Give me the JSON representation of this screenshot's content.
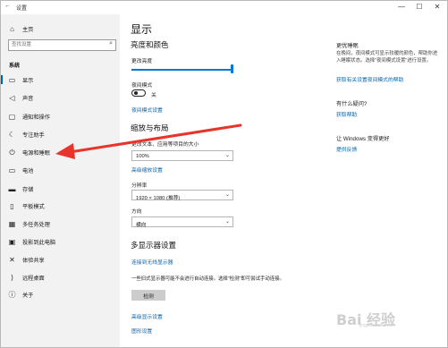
{
  "window": {
    "title": "设置",
    "minimize": "—",
    "maximize": "☐",
    "close": "✕"
  },
  "sidebar": {
    "home": "主页",
    "search_placeholder": "查找设置",
    "section": "系统",
    "items": [
      {
        "label": "显示",
        "icon": "monitor-icon"
      },
      {
        "label": "声音",
        "icon": "speaker-icon"
      },
      {
        "label": "通知和操作",
        "icon": "notification-icon"
      },
      {
        "label": "专注助手",
        "icon": "moon-icon"
      },
      {
        "label": "电源和睡眠",
        "icon": "power-icon"
      },
      {
        "label": "电池",
        "icon": "battery-icon"
      },
      {
        "label": "存储",
        "icon": "storage-icon"
      },
      {
        "label": "平板模式",
        "icon": "tablet-icon"
      },
      {
        "label": "多任务处理",
        "icon": "multitask-icon"
      },
      {
        "label": "投影到此电脑",
        "icon": "project-icon"
      },
      {
        "label": "体验共享",
        "icon": "share-icon"
      },
      {
        "label": "远程桌面",
        "icon": "remote-icon"
      },
      {
        "label": "关于",
        "icon": "info-icon"
      }
    ]
  },
  "main": {
    "title": "显示",
    "brightness_heading": "亮度和颜色",
    "brightness_label": "更改亮度",
    "brightness_level": 1.0,
    "night_light_label": "夜间模式",
    "night_light_state": "关",
    "night_light_link": "夜间模式设置",
    "scale_heading": "缩放与布局",
    "scale_label": "更改文本、应用等项目的大小",
    "scale_value": "100%",
    "scale_link": "高级缩放设置",
    "resolution_label": "分辨率",
    "resolution_value": "1920 × 1080 (推荐)",
    "orientation_label": "方向",
    "orientation_value": "横向",
    "multi_heading": "多显示器设置",
    "wireless_link": "连接到无线显示器",
    "detect_text": "一些旧式显示器可能不会进行自动连接。选择\"检测\"即可尝试手动连接。",
    "detect_button": "检测",
    "advanced_link": "高级显示设置",
    "graphics_link": "图形设置"
  },
  "right": {
    "sleep_heading": "更优睡眠",
    "sleep_text": "在晚间，夜间模式可显示较暖的颜色，帮助你进入睡眠状态。选择\"夜间模式设置\"进行设置。",
    "sleep_link": "获取有关设置夜间模式的帮助",
    "question_heading": "有什么疑问?",
    "help_link": "获取帮助",
    "better_heading": "让 Windows 变得更好",
    "feedback_link": "提供反馈"
  },
  "watermark": {
    "text": "Bai 经验",
    "sub": "jingyan.baidu.com"
  },
  "colors": {
    "accent": "#0063b1",
    "annotation_arrow": "#e8342a",
    "sidebar_bg": "#f2f2f2"
  }
}
